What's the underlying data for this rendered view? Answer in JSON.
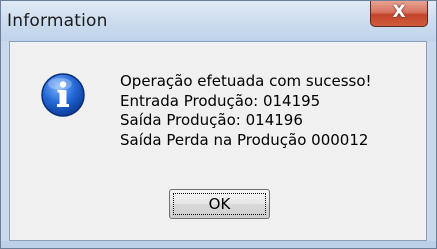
{
  "window": {
    "title": "Information",
    "close_glyph": "X"
  },
  "dialog": {
    "icon": "info-icon",
    "message_lines": [
      "Operação efetuada com sucesso!",
      "Entrada Produção: 014195",
      "Saída Produção: 014196",
      "Saída Perda na Produção 000012"
    ],
    "ok_label": "OK"
  },
  "colors": {
    "titlebar": "#cfdeef",
    "close_button": "#c2452b",
    "client_background": "#f0f0f0",
    "icon_blue": "#1a5fc8"
  }
}
